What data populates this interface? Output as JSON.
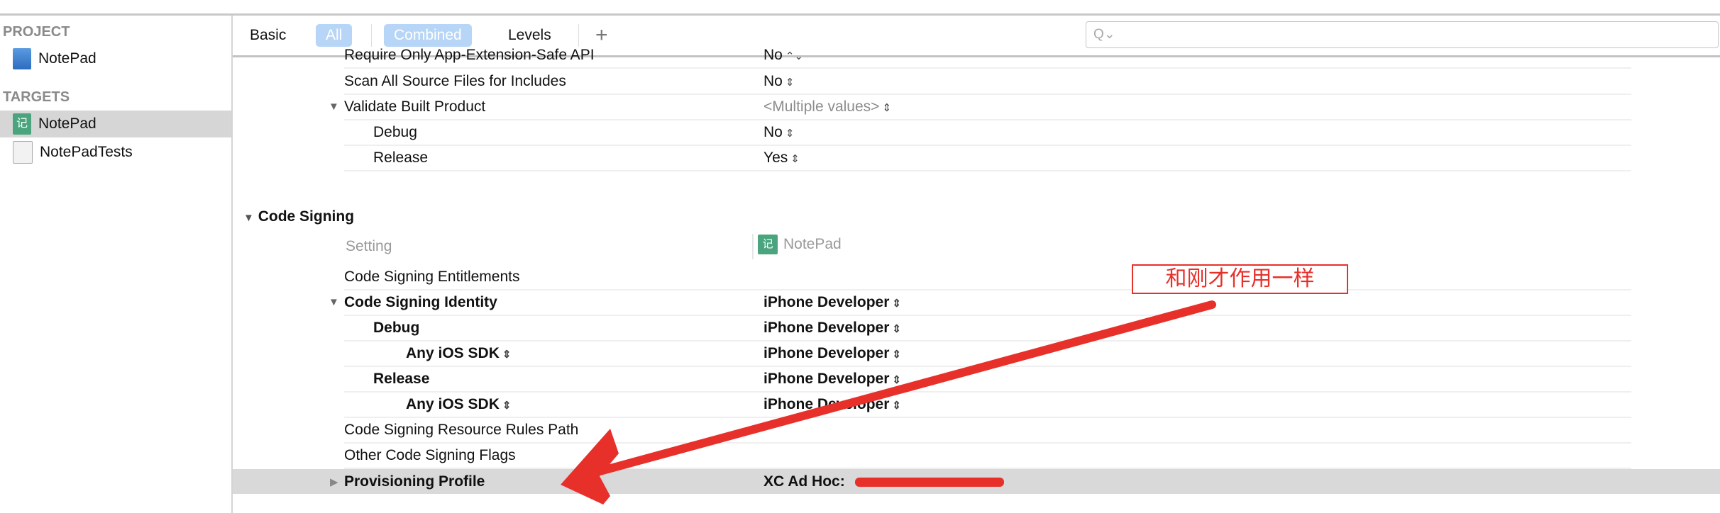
{
  "sidebar": {
    "project_header": "PROJECT",
    "project_item": "NotePad",
    "targets_header": "TARGETS",
    "targets": [
      {
        "label": "NotePad",
        "selected": true
      },
      {
        "label": "NotePadTests",
        "selected": false
      }
    ]
  },
  "toolbar": {
    "basic": "Basic",
    "all": "All",
    "combined": "Combined",
    "levels": "Levels",
    "add": "+",
    "search_icon": "Q⌄",
    "search_placeholder": ""
  },
  "settings_top": [
    {
      "name": "Require Only App-Extension-Safe API",
      "value": "No"
    },
    {
      "name": "Scan All Source Files for Includes",
      "value": "No"
    },
    {
      "name": "Validate Built Product",
      "value": "<Multiple values>"
    },
    {
      "name": "Debug",
      "value": "No"
    },
    {
      "name": "Release",
      "value": "Yes"
    }
  ],
  "code_signing": {
    "section_title": "Code Signing",
    "setting_header": "Setting",
    "target_header": "NotePad",
    "target_icon_glyph": "记",
    "rows": [
      {
        "name": "Code Signing Entitlements",
        "value": ""
      },
      {
        "name": "Code Signing Identity",
        "value": "iPhone Developer"
      },
      {
        "name": "Debug",
        "value": "iPhone Developer"
      },
      {
        "name": "Any iOS SDK",
        "value": "iPhone Developer"
      },
      {
        "name": "Release",
        "value": "iPhone Developer"
      },
      {
        "name": "Any iOS SDK",
        "value": "iPhone Developer"
      },
      {
        "name": "Code Signing Resource Rules Path",
        "value": ""
      },
      {
        "name": "Other Code Signing Flags",
        "value": ""
      },
      {
        "name": "Provisioning Profile",
        "value": "XC Ad Hoc:"
      }
    ]
  },
  "annotation": {
    "text": "和刚才作用一样",
    "color": "#e8302a"
  },
  "colors": {
    "accent": "#b7d5f7",
    "selection": "#d6d6d6",
    "target_icon": "#4aa57e"
  }
}
